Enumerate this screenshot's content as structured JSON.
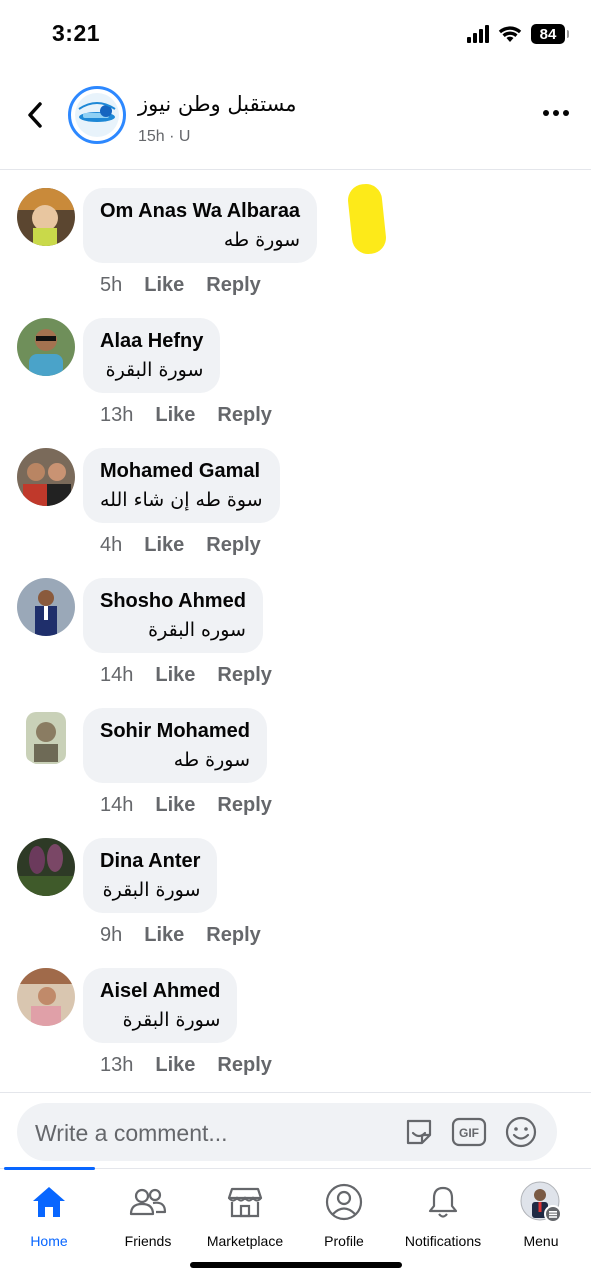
{
  "status_bar": {
    "time": "3:21",
    "battery": "84"
  },
  "header": {
    "page_name": "مستقبل وطن نيوز",
    "meta": "15h · U"
  },
  "comments": [
    {
      "name": "Om Anas Wa Albaraa",
      "text": "سورة طه",
      "time": "5h",
      "like": "Like",
      "reply": "Reply"
    },
    {
      "name": "Alaa Hefny",
      "text": "سورة البقرة",
      "time": "13h",
      "like": "Like",
      "reply": "Reply"
    },
    {
      "name": "Mohamed Gamal",
      "text": "سوة طه إن شاء الله",
      "time": "4h",
      "like": "Like",
      "reply": "Reply"
    },
    {
      "name": "Shosho Ahmed",
      "text": "سوره البقرة",
      "time": "14h",
      "like": "Like",
      "reply": "Reply"
    },
    {
      "name": "Sohir Mohamed",
      "text": "سورة طه",
      "time": "14h",
      "like": "Like",
      "reply": "Reply"
    },
    {
      "name": "Dina Anter",
      "text": "سورة البقرة",
      "time": "9h",
      "like": "Like",
      "reply": "Reply"
    },
    {
      "name": "Aisel Ahmed",
      "text": "سورة البقرة",
      "time": "13h",
      "like": "Like",
      "reply": "Reply"
    }
  ],
  "composer": {
    "placeholder": "Write a comment..."
  },
  "nav": [
    {
      "label": "Home",
      "icon": "home-icon",
      "active": true
    },
    {
      "label": "Friends",
      "icon": "friends-icon"
    },
    {
      "label": "Marketplace",
      "icon": "marketplace-icon"
    },
    {
      "label": "Profile",
      "icon": "profile-icon"
    },
    {
      "label": "Notifications",
      "icon": "bell-icon"
    },
    {
      "label": "Menu",
      "icon": "menu-avatar"
    }
  ],
  "colors": {
    "accent": "#0866ff",
    "bubble": "#f0f2f5",
    "muted": "#65676b",
    "highlight": "#fde800"
  }
}
